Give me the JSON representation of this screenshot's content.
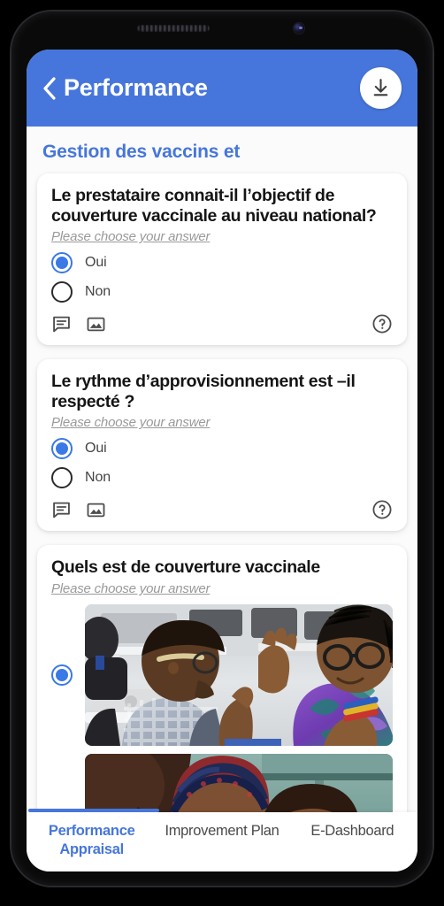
{
  "appbar": {
    "back_icon": "chevron-left-icon",
    "title": "Performance",
    "download_icon": "download-icon"
  },
  "section": {
    "title": "Gestion des vaccins et"
  },
  "answer_hint": "Please choose your answer",
  "icons": {
    "comment": "comment-icon",
    "image": "image-icon",
    "help": "help-circle-icon"
  },
  "questions": [
    {
      "text": "Le prestataire connait-il l’objectif de couverture vaccinale au niveau national?",
      "hint": "Please choose your answer",
      "options": [
        {
          "label": "Oui",
          "selected": true
        },
        {
          "label": "Non",
          "selected": false
        }
      ],
      "has_actions": true
    },
    {
      "text": "Le rythme d’approvisionnement est –il respecté ?",
      "hint": "Please choose your answer",
      "options": [
        {
          "label": "Oui",
          "selected": true
        },
        {
          "label": "Non",
          "selected": false
        }
      ],
      "has_actions": true
    },
    {
      "text": "Quels est de couverture vaccinale",
      "hint": "Please choose your answer",
      "options": [
        {
          "label": "",
          "selected": true,
          "type": "photo",
          "photo_alt": "two colleagues high-fiving in an office"
        },
        {
          "label": "",
          "selected": false,
          "type": "photo",
          "photo_alt": "mother holding a baby outdoors"
        }
      ],
      "has_actions": false
    }
  ],
  "tabs": [
    {
      "label": "Performance Appraisal",
      "active": true
    },
    {
      "label": "Improvement Plan",
      "active": false
    },
    {
      "label": "E-Dashboard",
      "active": false
    }
  ],
  "colors": {
    "accent": "#4676DB",
    "radio_selected": "#3A79E6",
    "hint_text": "#9a9a9a",
    "page_bg": "#fbfbfb",
    "card_bg": "#ffffff"
  }
}
